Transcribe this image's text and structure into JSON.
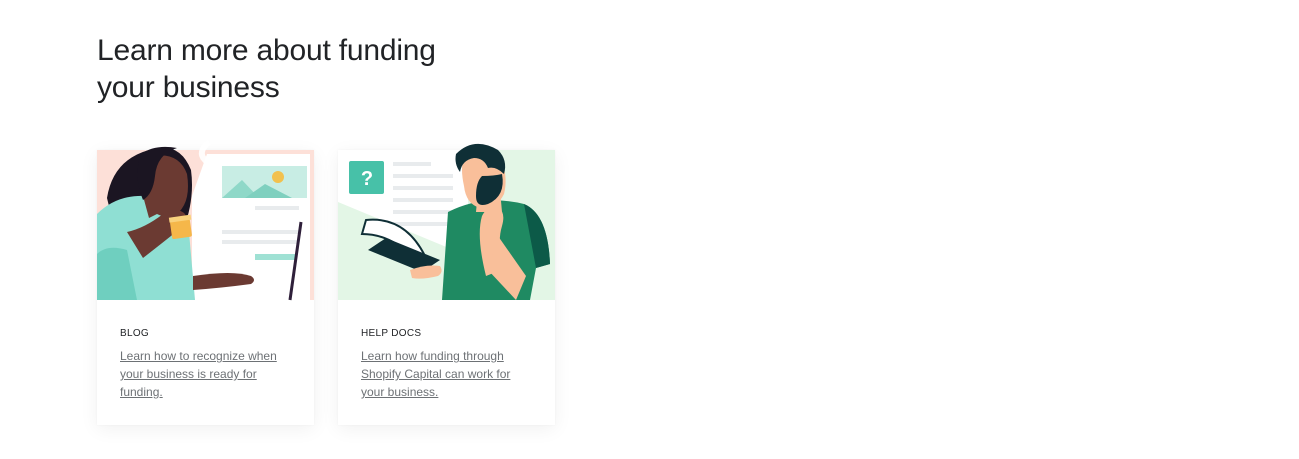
{
  "section": {
    "title": "Learn more about funding your business"
  },
  "cards": [
    {
      "label": "BLOG",
      "link_text": "Learn how to recognize when your business is ready for funding.",
      "illustration": "woman-drinking-coffee-at-laptop",
      "accent_color": "#fde0d8"
    },
    {
      "label": "HELP DOCS",
      "link_text": "Learn how funding through Shopify Capital can work for your business.",
      "illustration": "man-reading-help-document",
      "accent_color": "#e3f6e6"
    }
  ],
  "colors": {
    "heading": "#212326",
    "link": "#6d7175",
    "green_brand": "#47c1a8"
  }
}
